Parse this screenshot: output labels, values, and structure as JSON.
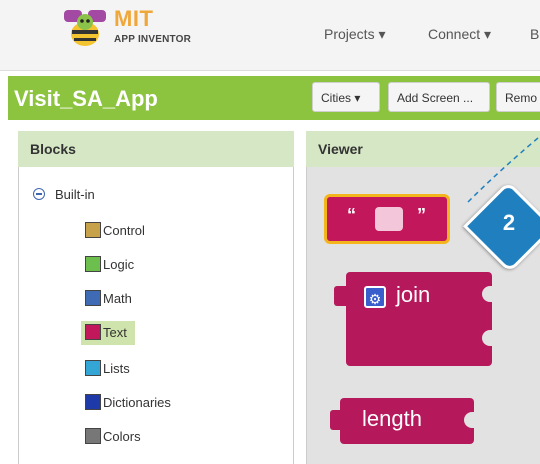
{
  "logo": {
    "brand": "MIT",
    "product": "APP INVENTOR"
  },
  "nav": [
    {
      "label": "Projects ▾"
    },
    {
      "label": "Connect ▾"
    },
    {
      "label": "B"
    }
  ],
  "project": {
    "name": "Visit_SA_App",
    "screen_selector": "Cities ▾",
    "add_screen": "Add Screen ...",
    "remove_screen": "Remo"
  },
  "blocks_panel": {
    "title": "Blocks",
    "tree_root": "Built-in",
    "categories": [
      {
        "label": "Control",
        "color": "#c8a24a"
      },
      {
        "label": "Logic",
        "color": "#6cbf4c"
      },
      {
        "label": "Math",
        "color": "#3f6bb5"
      },
      {
        "label": "Text",
        "color": "#c2185b",
        "selected": true
      },
      {
        "label": "Lists",
        "color": "#34a6d6"
      },
      {
        "label": "Dictionaries",
        "color": "#1e3aa8"
      },
      {
        "label": "Colors",
        "color": "#777777"
      }
    ]
  },
  "viewer": {
    "title": "Viewer",
    "blocks": {
      "text_open_quote": "“",
      "text_close_quote": "”",
      "join": "join",
      "length": "length"
    }
  },
  "annotation": {
    "number": "2",
    "color": "#1f7fbf"
  }
}
